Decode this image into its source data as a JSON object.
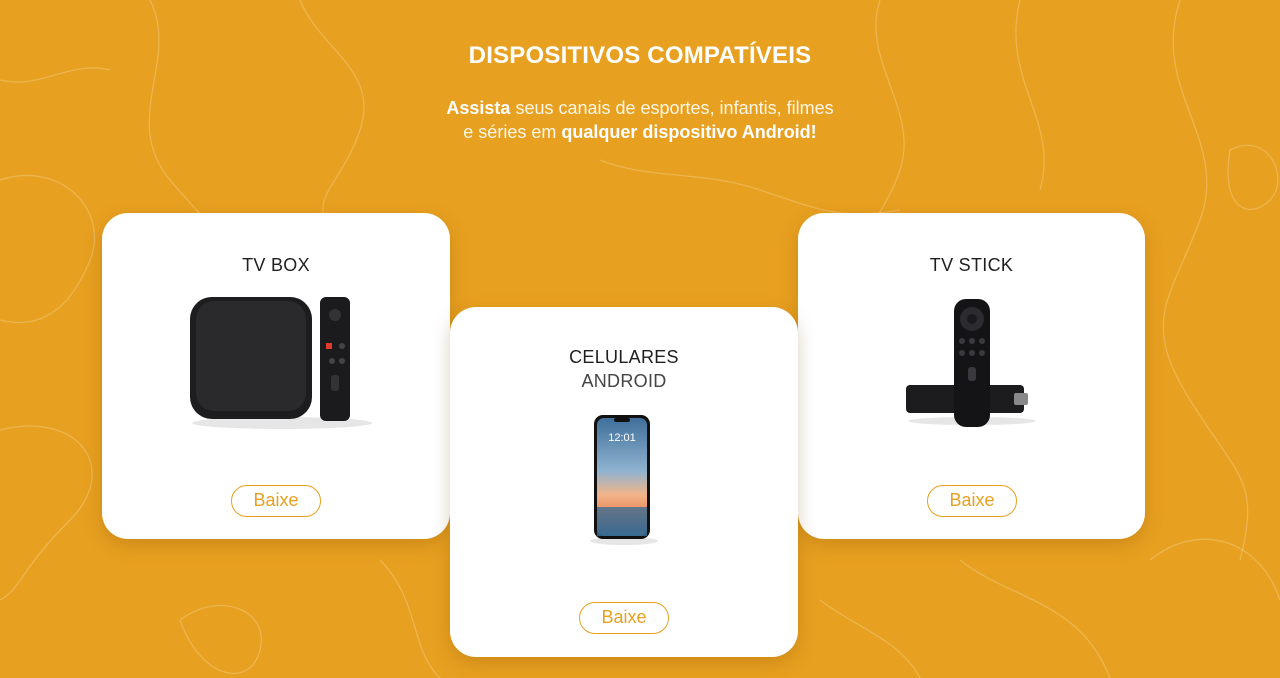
{
  "section": {
    "title": "DISPOSITIVOS COMPATÍVEIS",
    "subtitle_line1": {
      "bold": "Assista",
      "rest": " seus canais de esportes, infantis, filmes"
    },
    "subtitle_line2": {
      "pre": "e séries em ",
      "bold": "qualquer dispositivo Android!"
    }
  },
  "cards": [
    {
      "title": "TV BOX",
      "subtitle": "",
      "image_icon": "tv-box-with-remote",
      "button_label": "Baixe"
    },
    {
      "title": "CELULARES",
      "subtitle": "ANDROID",
      "image_icon": "android-smartphone",
      "phone_time": "12:01",
      "button_label": "Baixe"
    },
    {
      "title": "TV STICK",
      "subtitle": "",
      "image_icon": "tv-stick-with-remote",
      "button_label": "Baixe"
    }
  ],
  "colors": {
    "background": "#E8A020",
    "card": "#FFFFFF",
    "button_border": "#E8A020"
  }
}
